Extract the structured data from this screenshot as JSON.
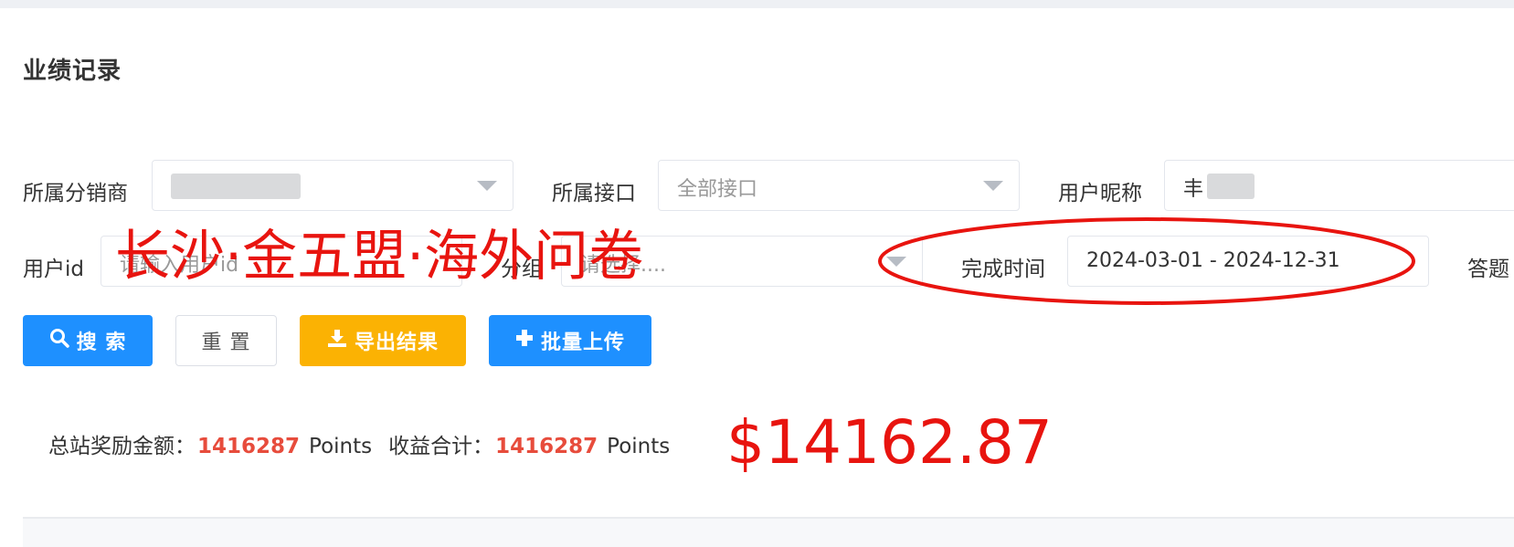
{
  "page": {
    "title": "业绩记录"
  },
  "filters": {
    "distributor": {
      "label": "所属分销商",
      "value": ""
    },
    "interface": {
      "label": "所属接口",
      "value": "全部接口"
    },
    "nickname": {
      "label": "用户昵称",
      "value": "丰"
    },
    "user_id": {
      "label": "用户id",
      "placeholder": "请输入用户id"
    },
    "group": {
      "label": "分组",
      "placeholder": "请选择...."
    },
    "finish_time": {
      "label": "完成时间",
      "value": "2024-03-01 - 2024-12-31"
    },
    "answer": {
      "label": "答题"
    }
  },
  "buttons": {
    "search": "搜 索",
    "reset": "重 置",
    "export": "导出结果",
    "batch_upload": "批量上传"
  },
  "summary": {
    "total_label": "总站奖励金额：",
    "total_value": "1416287",
    "total_unit": "Points",
    "income_label": "收益合计：",
    "income_value": "1416287",
    "income_unit": "Points"
  },
  "annotations": {
    "overlay_title": "长沙·金五盟·海外问卷",
    "overlay_amount": "$14162.87"
  },
  "colors": {
    "primary": "#1e90ff",
    "warning": "#fbb203",
    "highlight": "#e74c3c",
    "annotation": "#e8140f"
  }
}
